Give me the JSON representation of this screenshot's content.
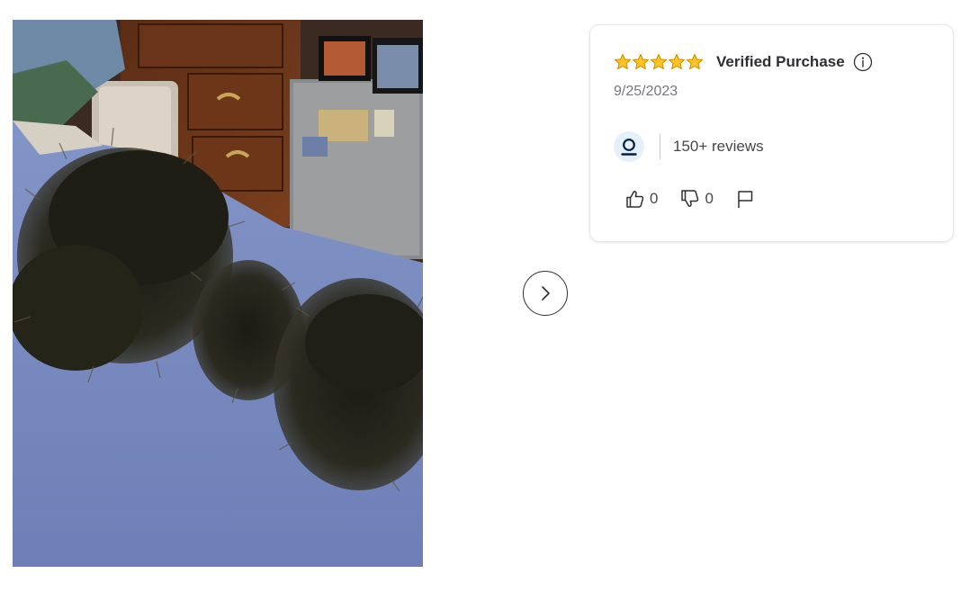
{
  "photo": {
    "alt_icon": "review-photo"
  },
  "navigation": {
    "next_icon": "chevron-right-icon"
  },
  "review": {
    "rating": 5,
    "rating_max": 5,
    "star_color": "#ffc220",
    "verified_label": "Verified Purchase",
    "date": "9/25/2023",
    "reviewer_review_count": "150+ reviews",
    "helpful_count": "0",
    "unhelpful_count": "0"
  },
  "colors": {
    "text_primary": "#2e2f32",
    "text_secondary": "#74767c",
    "avatar_bg": "#e5f0fa",
    "avatar_icon": "#041e42"
  }
}
